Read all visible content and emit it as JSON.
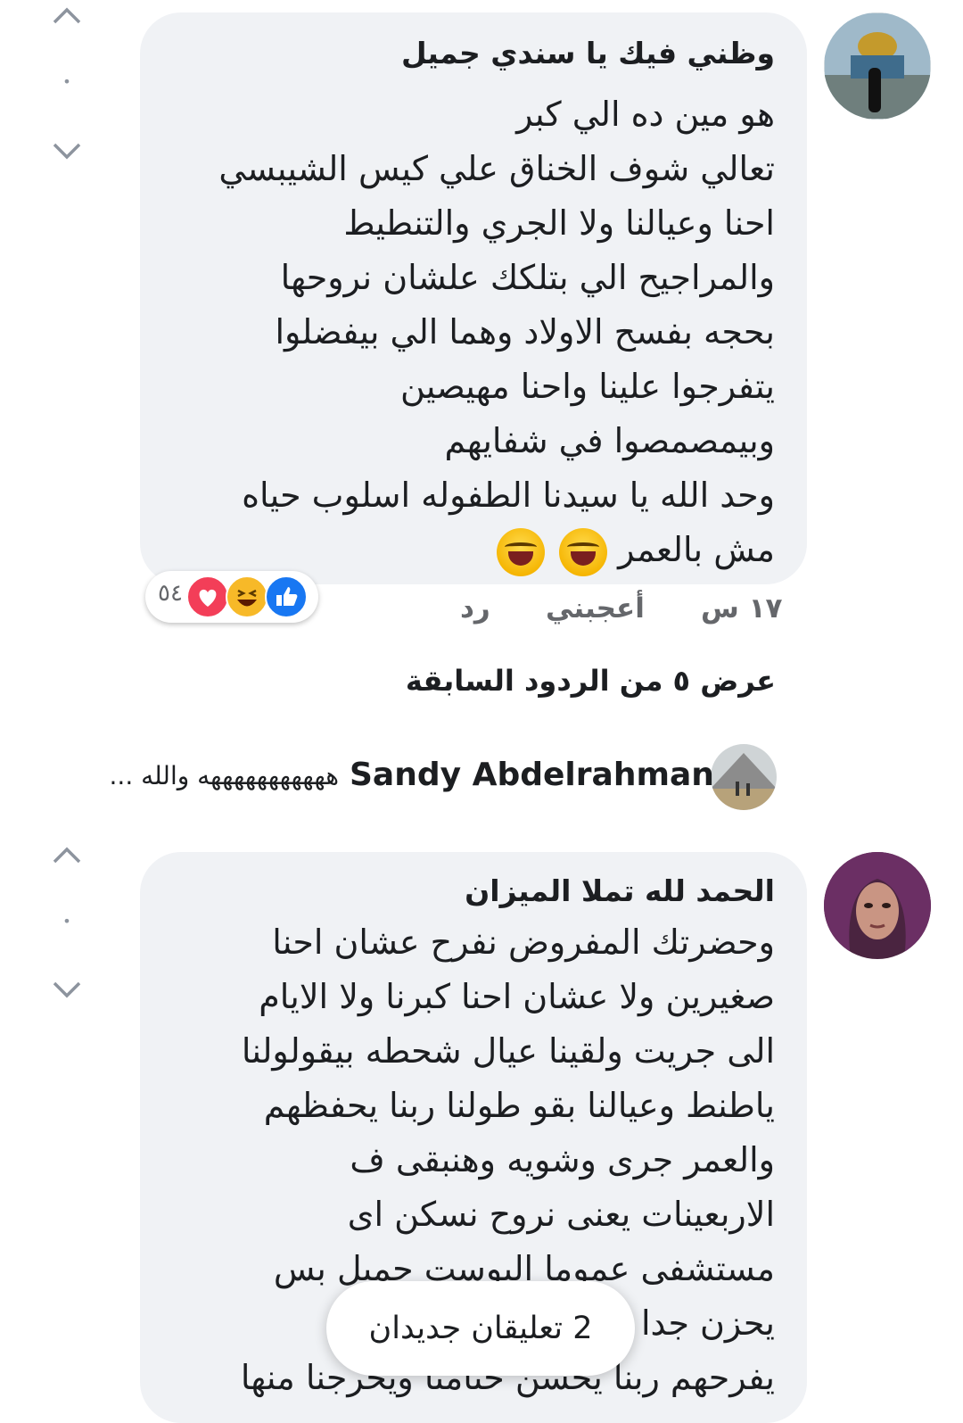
{
  "comment1": {
    "author": "وظني فيك يا سندي جميل",
    "lines": [
      "هو مين ده الي كبر",
      "تعالي شوف الخناق علي كيس الشيبسي",
      "احنا وعيالنا ولا الجري والتنطيط",
      "والمراجيح الي بتلكك علشان نروحها",
      "بحجه بفسح الاولاد وهما الي بيفضلوا",
      "يتفرجوا علينا واحنا مهيصين",
      "وبيمصمصوا في شفايهم",
      "وحد الله يا سيدنا الطفوله اسلوب حياه",
      "مش بالعمر"
    ],
    "time": "١٧ س",
    "like_label": "أعجبني",
    "reply_label": "رد",
    "reaction_count": "٥٤",
    "reaction_icons": [
      "like-icon",
      "haha-icon",
      "love-icon"
    ],
    "line_emojis": [
      "laughing-tears-emoji",
      "laughing-tears-emoji"
    ]
  },
  "previous_replies": "عرض ٥ من الردود السابقة",
  "reply_preview": {
    "name": "Sandy Abdelrahman",
    "text": "هههههههههههه والله ..."
  },
  "comment2": {
    "author": "الحمد لله تملا الميزان",
    "lines": [
      "وحضرتك المفروض نفرح عشان احنا",
      "صغيرين ولا عشان احنا كبرنا ولا الايام",
      "الى جريت ولقينا عيال شحطه بيقولولنا",
      "ياطنط وعيالنا بقو طولنا ربنا يحفظهم",
      "والعمر جرى وشويه وهنبقى ف",
      "الاربعينات يعنى نروح نسكن اى",
      "مستشفى عموما البوست جميل بس",
      "يحزن جدا انه",
      "يفرحهم ربنا يحسن ختامنا ويخرجنا منها"
    ]
  },
  "new_comments_toast": "2 تعليقان جديدان",
  "vote_dot": "•",
  "colors": {
    "bubble": "#f0f2f5",
    "meta_text": "#65676b",
    "like_blue": "#1877f2",
    "love_red": "#f33e58",
    "haha_yellow": "#f7b928"
  }
}
